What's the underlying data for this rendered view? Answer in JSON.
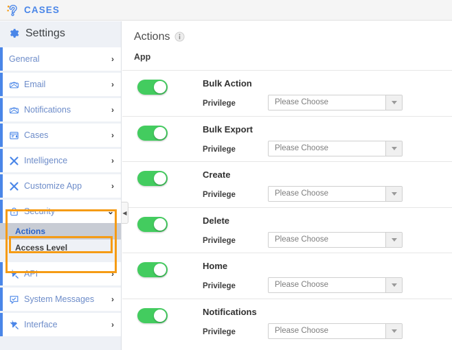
{
  "topbar": {
    "brand": "CASES",
    "logo_icon": "ear-question-logo-icon",
    "brand_color": "#4a86e8"
  },
  "sidebar": {
    "heading": "Settings",
    "heading_icon": "gear-icon",
    "items": [
      {
        "label": "General",
        "icon": null,
        "chevron": "›"
      },
      {
        "label": "Email",
        "icon": "envelope-icon",
        "chevron": "›"
      },
      {
        "label": "Notifications",
        "icon": "envelope-icon",
        "chevron": "›"
      },
      {
        "label": "Cases",
        "icon": "document-icon",
        "chevron": "›"
      },
      {
        "label": "Intelligence",
        "icon": "tools-icon",
        "chevron": "›"
      },
      {
        "label": "Customize App",
        "icon": "tools-icon",
        "chevron": "›"
      }
    ],
    "security": {
      "label": "Security",
      "icon": "lock-icon",
      "chevron": "⌄",
      "expanded": true,
      "sub_items": [
        {
          "label": "Actions",
          "active": true
        },
        {
          "label": "Access Level",
          "active": false
        }
      ]
    },
    "items_after": [
      {
        "label": "API",
        "icon": "plug-icon",
        "chevron": "›"
      },
      {
        "label": "System Messages",
        "icon": "speech-check-icon",
        "chevron": "›"
      },
      {
        "label": "Interface",
        "icon": "plug-icon",
        "chevron": "›"
      }
    ],
    "highlight_color": "#f59b14"
  },
  "collapse_handle": {
    "icon": "chevron-left-icon",
    "glyph": "◀"
  },
  "main": {
    "title": "Actions",
    "title_info_icon": "info-icon",
    "section_label": "App",
    "privilege_label": "Privilege",
    "select_placeholder": "Please Choose",
    "toggle_on_color": "#43cc5f",
    "rows": [
      {
        "name": "Bulk Action",
        "enabled": true,
        "privilege": "Please Choose"
      },
      {
        "name": "Bulk Export",
        "enabled": true,
        "privilege": "Please Choose"
      },
      {
        "name": "Create",
        "enabled": true,
        "privilege": "Please Choose"
      },
      {
        "name": "Delete",
        "enabled": true,
        "privilege": "Please Choose"
      },
      {
        "name": "Home",
        "enabled": true,
        "privilege": "Please Choose"
      },
      {
        "name": "Notifications",
        "enabled": true,
        "privilege": "Please Choose"
      }
    ]
  }
}
